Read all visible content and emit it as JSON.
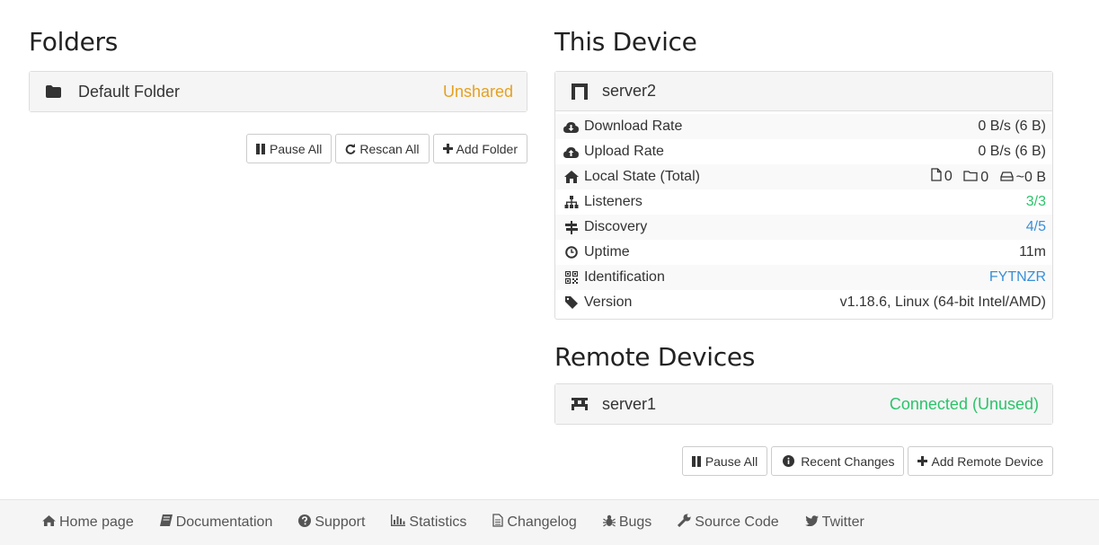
{
  "folders": {
    "heading": "Folders",
    "items": [
      {
        "name": "Default Folder",
        "status": "Unshared",
        "icon": "folder-icon"
      }
    ],
    "buttons": {
      "pause_all": "Pause All",
      "rescan_all": "Rescan All",
      "add_folder": "Add Folder"
    }
  },
  "this_device": {
    "heading": "This Device",
    "name": "server2",
    "rows": {
      "download_rate": {
        "label": "Download Rate",
        "value": "0 B/s (6 B)"
      },
      "upload_rate": {
        "label": "Upload Rate",
        "value": "0 B/s (6 B)"
      },
      "local_state": {
        "label": "Local State (Total)",
        "files": "0",
        "dirs": "0",
        "size": "~0 B"
      },
      "listeners": {
        "label": "Listeners",
        "value": "3/3"
      },
      "discovery": {
        "label": "Discovery",
        "value": "4/5"
      },
      "uptime": {
        "label": "Uptime",
        "value": "11m"
      },
      "identification": {
        "label": "Identification",
        "value": "FYTNZR"
      },
      "version": {
        "label": "Version",
        "value": "v1.18.6, Linux (64-bit Intel/AMD)"
      }
    }
  },
  "remote_devices": {
    "heading": "Remote Devices",
    "items": [
      {
        "name": "server1",
        "status": "Connected (Unused)"
      }
    ],
    "buttons": {
      "pause_all": "Pause All",
      "recent_changes": "Recent Changes",
      "add_remote": "Add Remote Device"
    }
  },
  "footer": {
    "links": [
      "Home page",
      "Documentation",
      "Support",
      "Statistics",
      "Changelog",
      "Bugs",
      "Source Code",
      "Twitter"
    ]
  },
  "colors": {
    "unshared": "#e5a021",
    "connected": "#2cc36b",
    "link": "#3a8fd8"
  }
}
